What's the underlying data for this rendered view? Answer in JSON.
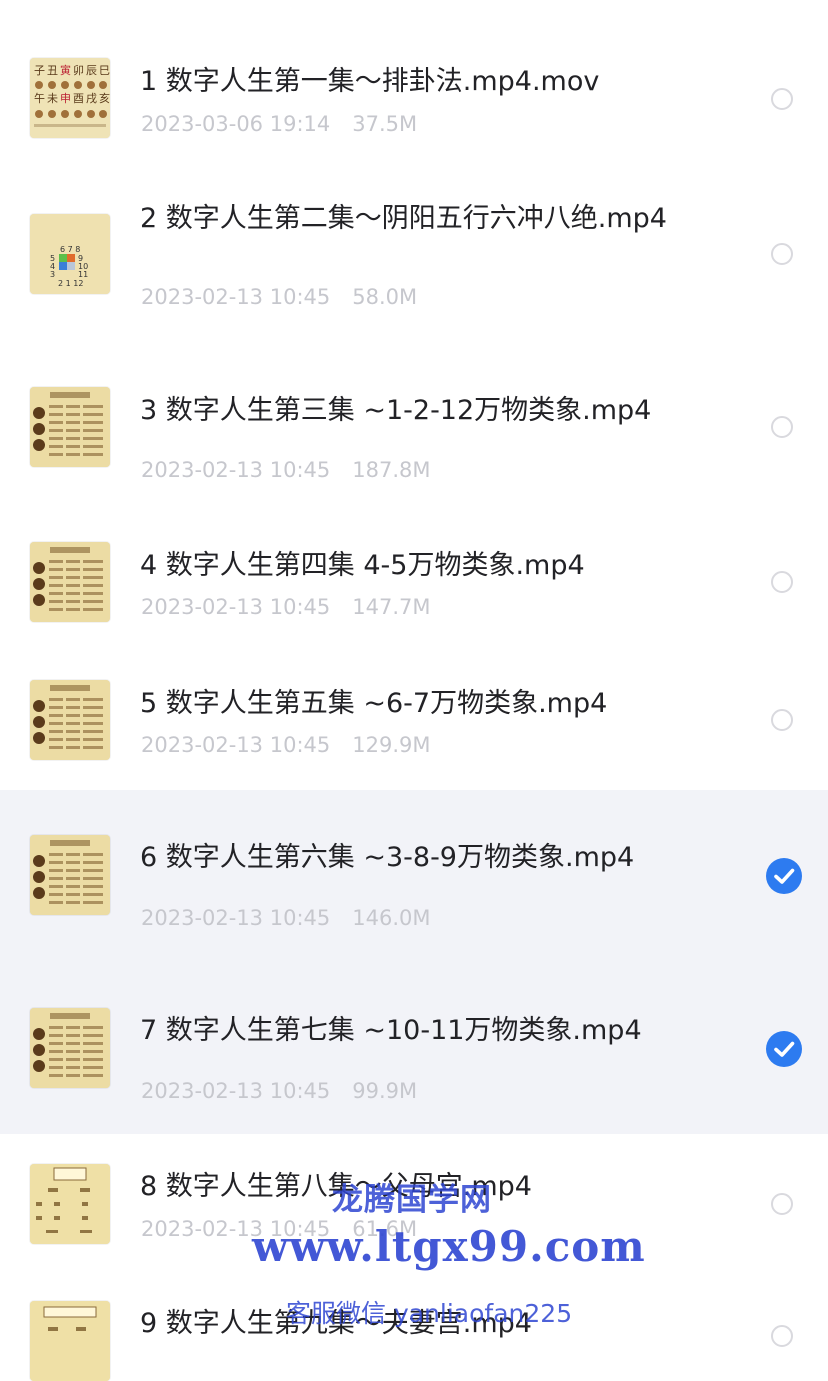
{
  "files": [
    {
      "title": "1 数字人生第一集～排卦法.mp4.mov",
      "date": "2023-03-06 19:14",
      "size": "37.5M",
      "selected": false,
      "thumb": "zodiac-chart"
    },
    {
      "title": "2 数字人生第二集～阴阳五行六冲八绝.mp4",
      "date": "2023-02-13 10:45",
      "size": "58.0M",
      "selected": false,
      "thumb": "number-grid"
    },
    {
      "title": "3 数字人生第三集 ~1-2-12万物类象.mp4",
      "date": "2023-02-13 10:45",
      "size": "187.8M",
      "selected": false,
      "thumb": "table-sheet"
    },
    {
      "title": "4 数字人生第四集 4-5万物类象.mp4",
      "date": "2023-02-13 10:45",
      "size": "147.7M",
      "selected": false,
      "thumb": "table-sheet"
    },
    {
      "title": "5 数字人生第五集 ~6-7万物类象.mp4",
      "date": "2023-02-13 10:45",
      "size": "129.9M",
      "selected": false,
      "thumb": "table-sheet"
    },
    {
      "title": "6 数字人生第六集 ~3-8-9万物类象.mp4",
      "date": "2023-02-13 10:45",
      "size": "146.0M",
      "selected": true,
      "thumb": "table-sheet"
    },
    {
      "title": "7 数字人生第七集 ~10-11万物类象.mp4",
      "date": "2023-02-13 10:45",
      "size": "99.9M",
      "selected": true,
      "thumb": "table-sheet"
    },
    {
      "title": "8 数字人生第八集～父母宫.mp4",
      "date": "2023-02-13 10:45",
      "size": "61.6M",
      "selected": false,
      "thumb": "case-card"
    },
    {
      "title": "9 数字人生第九集～夫妻宫.mp4",
      "date": "",
      "size": "",
      "selected": false,
      "thumb": "case-card-2"
    }
  ],
  "watermark": {
    "site_name": "龙腾国学网",
    "url": "www.ltgx99.com",
    "contact": "客服微信 yanliaofan225"
  },
  "colors": {
    "accent": "#2d7bf0",
    "selected_row_bg": "#f2f3f8",
    "title_text": "#222226",
    "meta_text": "#c6c7cd",
    "thumb_bg": "#e8d79e",
    "watermark": "#2f46d2"
  }
}
